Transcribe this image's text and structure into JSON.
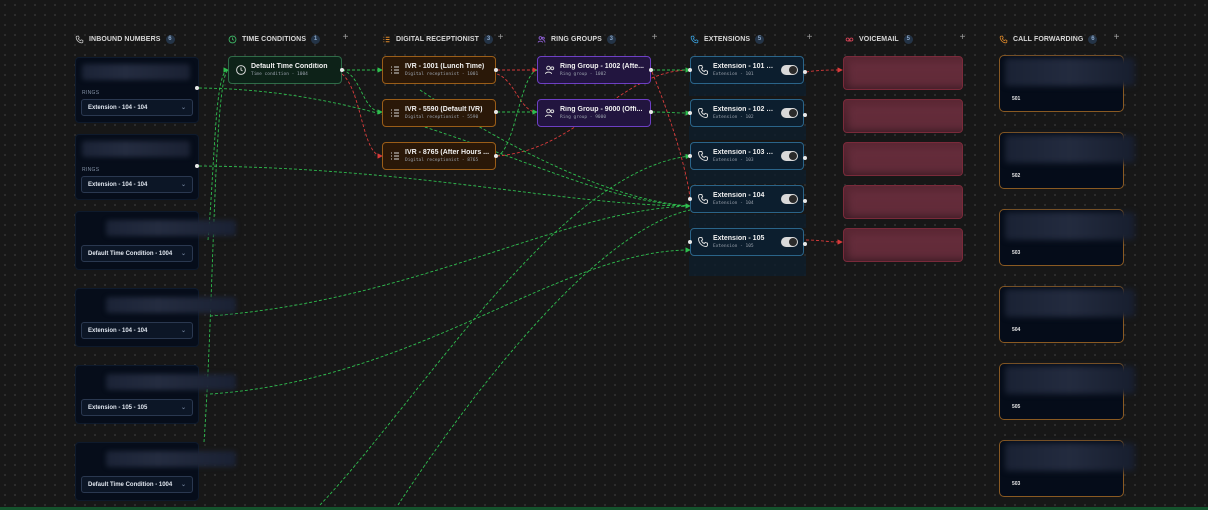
{
  "columns": {
    "inbound": {
      "label": "INBOUND NUMBERS",
      "count": "6"
    },
    "time_conditions": {
      "label": "TIME CONDITIONS",
      "count": "1"
    },
    "digital_receptionist": {
      "label": "DIGITAL RECEPTIONIST",
      "count": "3"
    },
    "ring_groups": {
      "label": "RING GROUPS",
      "count": "3"
    },
    "extensions": {
      "label": "EXTENSIONS",
      "count": "5"
    },
    "voicemail": {
      "label": "VOICEMAIL",
      "count": "5"
    },
    "call_forwarding": {
      "label": "CALL FORWARDING",
      "count": "6"
    }
  },
  "add_symbol": "+",
  "inbound_numbers": [
    {
      "label": "RINGS",
      "target": "Extension - 104 - 104"
    },
    {
      "label": "RINGS",
      "target": "Extension - 104 - 104"
    },
    {
      "label": "",
      "target": "Default Time Condition - 1004"
    },
    {
      "label": "",
      "target": "Extension - 104 - 104"
    },
    {
      "label": "",
      "target": "Extension - 105 - 105"
    },
    {
      "label": "",
      "target": "Default Time Condition - 1004"
    }
  ],
  "time_conditions": [
    {
      "title": "Default Time Condition",
      "sub": "Time condition - 1004"
    }
  ],
  "digital_receptionists": [
    {
      "title": "IVR - 1001 (Lunch Time)",
      "sub": "Digital receptionist - 1001"
    },
    {
      "title": "IVR - 5590 (Default IVR)",
      "sub": "Digital receptionist - 5590"
    },
    {
      "title": "IVR - 8765 (After Hours ...",
      "sub": "Digital receptionist - 8765"
    }
  ],
  "ring_groups": [
    {
      "title": "Ring Group - 1002 (Afte...",
      "sub": "Ring group - 1002"
    },
    {
      "title": "Ring Group - 9000 (Offi...",
      "sub": "Ring group - 9000"
    }
  ],
  "extensions": [
    {
      "title": "Extension - 101 (A...",
      "sub": "Extension - 101",
      "enabled": true
    },
    {
      "title": "Extension - 102 (F...",
      "sub": "Extension - 102",
      "enabled": true
    },
    {
      "title": "Extension - 103 (L...",
      "sub": "Extension - 103",
      "enabled": true
    },
    {
      "title": "Extension - 104",
      "sub": "Extension - 104",
      "enabled": true
    },
    {
      "title": "Extension - 105",
      "sub": "Extension - 105",
      "enabled": true
    }
  ],
  "call_forwarding": [
    "501",
    "502",
    "503",
    "504",
    "505",
    "503"
  ],
  "colors": {
    "connection_active": "#2ebd4e",
    "connection_fallback": "#d93a3a",
    "time_condition_accent": "#2e6b47",
    "receptionist_accent": "#9a5d18",
    "ring_group_accent": "#6d3fc4",
    "extension_accent": "#2a6489",
    "voicemail_accent": "#7a2a3a",
    "forwarding_accent": "#8a5a22"
  }
}
